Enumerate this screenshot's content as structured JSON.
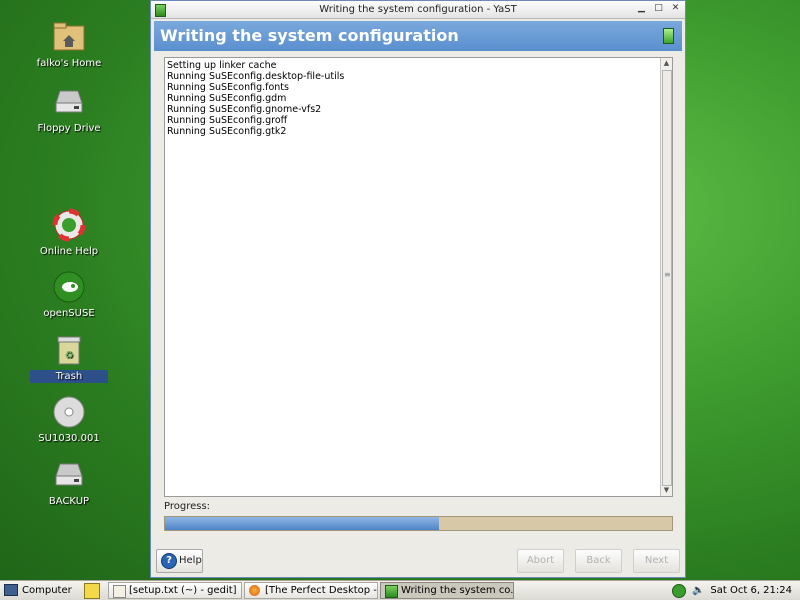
{
  "desktop": {
    "icons": [
      {
        "label": "falko's Home"
      },
      {
        "label": "Floppy Drive"
      },
      {
        "label": "Online Help"
      },
      {
        "label": "openSUSE"
      },
      {
        "label": "Trash"
      },
      {
        "label": "SU1030.001"
      },
      {
        "label": "BACKUP"
      }
    ]
  },
  "window": {
    "title": "Writing the system configuration - YaST",
    "header": "Writing the system configuration",
    "log_lines": [
      "Setting up linker cache",
      "Running SuSEconfig.desktop-file-utils",
      "Running SuSEconfig.fonts",
      "Running SuSEconfig.gdm",
      "Running SuSEconfig.gnome-vfs2",
      "Running SuSEconfig.groff",
      "Running SuSEconfig.gtk2"
    ],
    "progress_label": "Progress:",
    "progress_value": 0.54,
    "buttons": {
      "help": "Help",
      "abort": "Abort",
      "back": "Back",
      "next": "Next"
    }
  },
  "taskbar": {
    "computer": "Computer",
    "tasks": [
      {
        "label": "[setup.txt (~) - gedit]"
      },
      {
        "label": "[The Perfect Desktop - ..."
      },
      {
        "label": "Writing the system co..."
      }
    ],
    "clock": "Sat Oct 6, 21:24"
  }
}
